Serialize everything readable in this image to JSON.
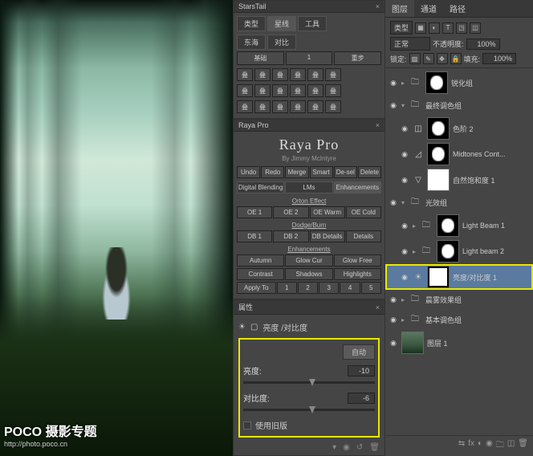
{
  "watermark": {
    "title": "POCO 摄影专题",
    "url": "http://photo.poco.cn"
  },
  "starstail": {
    "title": "StarsTail",
    "tabs": [
      "类型",
      "星线",
      "工具"
    ],
    "tabs2": [
      "东海",
      "对比"
    ],
    "row1": [
      "基础",
      "1",
      "重步"
    ],
    "grid": [
      "叠",
      "叠",
      "叠",
      "叠",
      "叠",
      "叠",
      "叠",
      "叠",
      "叠",
      "叠",
      "叠",
      "叠",
      "叠",
      "叠",
      "叠",
      "叠",
      "叠",
      "叠"
    ]
  },
  "raya": {
    "title": "Raya Pro",
    "by": "By Jimmy McIntyre",
    "row1": [
      "Undo",
      "Redo",
      "Merge",
      "Smart",
      "De-sel",
      "Delete"
    ],
    "tabs": [
      "Digital Blending",
      "LMs",
      "Enhancements"
    ],
    "orton": {
      "title": "Orton Effect",
      "btns": [
        "OE 1",
        "OE 2",
        "OE Warm",
        "OE Cold"
      ]
    },
    "dodge": {
      "title": "Dodge/Burn",
      "btns": [
        "DB 1",
        "DB 2",
        "DB Details",
        "Details"
      ]
    },
    "enh": {
      "title": "Enhancements",
      "r1": [
        "Autumn",
        "Glow Cur",
        "Glow Free"
      ],
      "r2": [
        "Contrast",
        "Shadows",
        "Highlights"
      ],
      "r3": [
        "Apply To",
        "1",
        "2",
        "3",
        "4",
        "5"
      ]
    }
  },
  "props": {
    "title": "属性",
    "type": "亮度 /对比度",
    "auto": "自动",
    "brightness": {
      "label": "亮度:",
      "value": "-10"
    },
    "contrast": {
      "label": "对比度:",
      "value": "-6"
    },
    "legacy": "使用旧版"
  },
  "layers_panel": {
    "tabs": [
      "图层",
      "通道",
      "路径"
    ],
    "kind": "类型",
    "blend": "正常",
    "opacity_lbl": "不透明度:",
    "opacity": "100%",
    "lock_lbl": "锁定:",
    "fill_lbl": "填充:",
    "fill": "100%",
    "groups": {
      "sharpen": "锐化组",
      "finalcolor": "最终调色组",
      "light": "光效组",
      "fog": "晨雾效果组",
      "basecolor": "基本调色组"
    },
    "items": {
      "levels2": "色阶 2",
      "midtones": "Midtones Cont...",
      "vibrance": "自然饱和度 1",
      "beam1": "Light Beam 1",
      "beam2": "Light beam 2",
      "bc1": "亮度/对比度 1",
      "bg": "图层 1"
    }
  }
}
